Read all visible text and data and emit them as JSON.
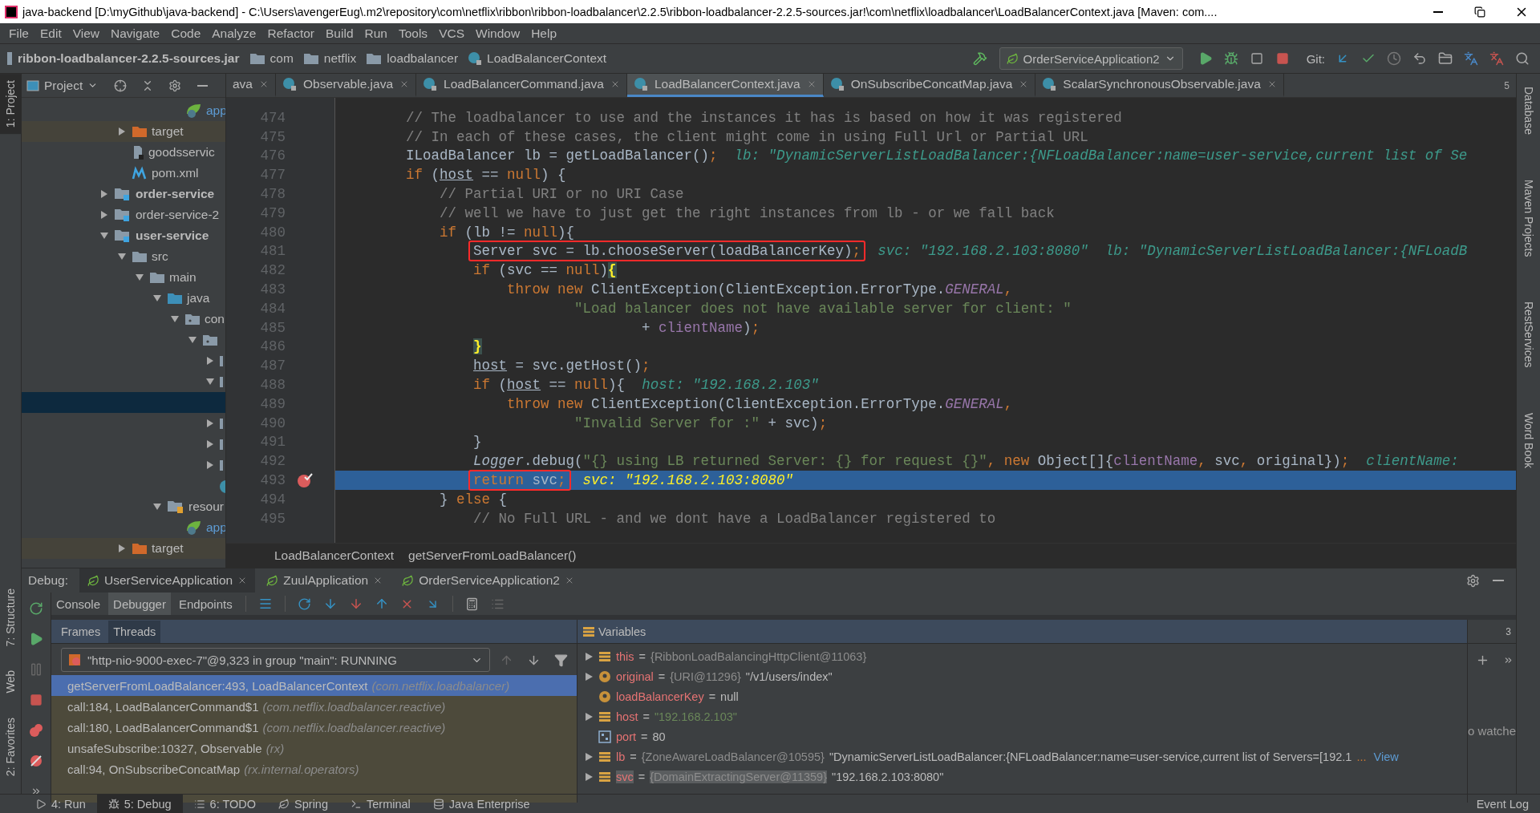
{
  "window": {
    "title": "java-backend [D:\\myGithub\\java-backend] - C:\\Users\\avengerEug\\.m2\\repository\\com\\netflix\\ribbon\\ribbon-loadbalancer\\2.2.5\\ribbon-loadbalancer-2.2.5-sources.jar!\\com\\netflix\\loadbalancer\\LoadBalancerContext.java [Maven: com...."
  },
  "menu": [
    "File",
    "Edit",
    "View",
    "Navigate",
    "Code",
    "Analyze",
    "Refactor",
    "Build",
    "Run",
    "Tools",
    "VCS",
    "Window",
    "Help"
  ],
  "nav_bar": {
    "path": [
      {
        "label": "ribbon-loadbalancer-2.2.5-sources.jar",
        "kind": "jar"
      },
      {
        "label": "com",
        "kind": "package"
      },
      {
        "label": "netflix",
        "kind": "package"
      },
      {
        "label": "loadbalancer",
        "kind": "package"
      },
      {
        "label": "LoadBalancerContext",
        "kind": "class"
      }
    ],
    "run_config": "OrderServiceApplication2",
    "git_label": "Git:"
  },
  "left_stripe": [
    {
      "label": "1: Project",
      "selected": true
    },
    {
      "label": "7: Structure",
      "selected": false
    },
    {
      "label": "Web",
      "selected": false
    },
    {
      "label": "2: Favorites",
      "selected": false
    }
  ],
  "right_stripe": [
    "Database",
    "Maven Projects",
    "RestServices",
    "Word Book"
  ],
  "project": {
    "title": "Project",
    "tree": [
      {
        "children": [
          {
            "children": [
              {
                "children": [
                  {
                    "children": [
                      {
                        "label": "app",
                        "kind": "spring-config"
                      }
                    ]
                  }
                ]
              }
            ]
          },
          {
            "label": "target",
            "kind": "excluded",
            "expanded": false,
            "highlighted": true
          },
          {
            "label": "goodsservic",
            "kind": "iml"
          },
          {
            "label": "pom.xml",
            "kind": "maven"
          }
        ]
      },
      {
        "label": "order-service",
        "kind": "module",
        "bold": true,
        "expanded": false
      },
      {
        "label": "order-service-2",
        "kind": "module",
        "bold": false,
        "expanded": false
      },
      {
        "label": "user-service",
        "kind": "module",
        "bold": true,
        "expanded": true,
        "children": [
          {
            "label": "src",
            "kind": "folder",
            "expanded": true,
            "children": [
              {
                "label": "main",
                "kind": "folder",
                "expanded": true,
                "children": [
                  {
                    "label": "java",
                    "kind": "source",
                    "expanded": true,
                    "children": [
                      {
                        "label": "con",
                        "kind": "package",
                        "expanded": true,
                        "children": [
                          {
                            "kind": "package",
                            "expanded": true,
                            "children": [
                              {
                                "kind": "cut",
                                "expanded": false
                              },
                              {
                                "kind": "cut",
                                "expanded": true,
                                "children": [
                                  {
                                    "selected": true
                                  }
                                ]
                              },
                              {
                                "kind": "cut",
                                "expanded": false
                              },
                              {
                                "kind": "cut",
                                "expanded": false
                              },
                              {
                                "kind": "cut",
                                "expanded": false
                              },
                              {
                                "kind": "spring-class"
                              }
                            ]
                          }
                        ]
                      }
                    ]
                  },
                  {
                    "label": "resour",
                    "kind": "resources",
                    "expanded": true,
                    "children": [
                      {
                        "label": "app",
                        "kind": "spring-config"
                      }
                    ]
                  }
                ]
              }
            ]
          },
          {
            "label": "target",
            "kind": "excluded",
            "expanded": false,
            "highlighted": true
          }
        ]
      }
    ]
  },
  "editor": {
    "tabs": [
      {
        "label": "ava",
        "selected": false,
        "icon": false
      },
      {
        "label": "Observable.java",
        "selected": false,
        "icon": true
      },
      {
        "label": "LoadBalancerCommand.java",
        "selected": false,
        "icon": true
      },
      {
        "label": "LoadBalancerContext.java",
        "selected": true,
        "icon": true
      },
      {
        "label": "OnSubscribeConcatMap.java",
        "selected": false,
        "icon": true
      },
      {
        "label": "ScalarSynchronousObservable.java",
        "selected": false,
        "icon": true
      }
    ],
    "tab_count": "5",
    "lines": [
      {
        "number": "474",
        "tokens": [
          {
            "kind": "comment",
            "text": "        // The loadbalancer to use and the instances it has is based on how it was registered"
          }
        ],
        "current": false,
        "breakpoint": false,
        "boxed": false
      },
      {
        "number": "475",
        "tokens": [
          {
            "kind": "comment",
            "text": "        // In each of these cases, the client might come in using Full Url or Partial URL"
          }
        ],
        "current": false,
        "breakpoint": false,
        "boxed": false
      },
      {
        "number": "476",
        "tokens": [
          {
            "kind": "plain",
            "text": "        ILoadBalancer lb = getLoadBalancer()"
          },
          {
            "kind": "punct",
            "text": ";"
          }
        ],
        "hint": "lb: \"DynamicServerListLoadBalancer:{NFLoadBalancer:name=user-service,current list of Se",
        "current": false,
        "breakpoint": false,
        "boxed": false
      },
      {
        "number": "477",
        "tokens": [
          {
            "kind": "keyword",
            "text": "        if"
          },
          {
            "kind": "plain",
            "text": " ("
          },
          {
            "kind": "underline",
            "text": "host"
          },
          {
            "kind": "plain",
            "text": " == "
          },
          {
            "kind": "keyword",
            "text": "null"
          },
          {
            "kind": "plain",
            "text": ") {"
          }
        ],
        "current": false,
        "breakpoint": false,
        "boxed": false
      },
      {
        "number": "478",
        "tokens": [
          {
            "kind": "comment",
            "text": "            // Partial URI or no URI Case"
          }
        ],
        "current": false,
        "breakpoint": false,
        "boxed": false
      },
      {
        "number": "479",
        "tokens": [
          {
            "kind": "comment",
            "text": "            // well we have to just get the right instances from lb - or we fall back"
          }
        ],
        "current": false,
        "breakpoint": false,
        "boxed": false
      },
      {
        "number": "480",
        "tokens": [
          {
            "kind": "keyword",
            "text": "            if"
          },
          {
            "kind": "plain",
            "text": " (lb != "
          },
          {
            "kind": "keyword",
            "text": "null"
          },
          {
            "kind": "plain",
            "text": "){"
          }
        ],
        "current": false,
        "breakpoint": false,
        "boxed": false
      },
      {
        "number": "481",
        "tokens": [
          {
            "kind": "plain",
            "text": "                Server svc = lb.chooseServer(loadBalancerKey)"
          },
          {
            "kind": "punct",
            "text": ";"
          }
        ],
        "hint": "svc: \"192.168.2.103:8080\"  lb: \"DynamicServerListLoadBalancer:{NFLoadB",
        "current": false,
        "breakpoint": false,
        "boxed": true
      },
      {
        "number": "482",
        "tokens": [
          {
            "kind": "keyword",
            "text": "                if"
          },
          {
            "kind": "plain",
            "text": " (svc == "
          },
          {
            "kind": "keyword",
            "text": "null"
          },
          {
            "kind": "plain",
            "text": ")"
          },
          {
            "kind": "brace",
            "text": "{"
          }
        ],
        "current": false,
        "breakpoint": false,
        "boxed": false
      },
      {
        "number": "483",
        "tokens": [
          {
            "kind": "keyword",
            "text": "                    throw new "
          },
          {
            "kind": "plain",
            "text": "ClientException(ClientException.ErrorType."
          },
          {
            "kind": "constant",
            "text": "GENERAL"
          },
          {
            "kind": "punct",
            "text": ","
          }
        ],
        "current": false,
        "breakpoint": false,
        "boxed": false
      },
      {
        "number": "484",
        "tokens": [
          {
            "kind": "string",
            "text": "                            \"Load balancer does not have available server for client: \""
          }
        ],
        "current": false,
        "breakpoint": false,
        "boxed": false
      },
      {
        "number": "485",
        "tokens": [
          {
            "kind": "plain",
            "text": "                                    + "
          },
          {
            "kind": "field",
            "text": "clientName"
          },
          {
            "kind": "plain",
            "text": ")"
          },
          {
            "kind": "punct",
            "text": ";"
          }
        ],
        "current": false,
        "breakpoint": false,
        "boxed": false
      },
      {
        "number": "486",
        "tokens": [
          {
            "kind": "brace",
            "text": "                }"
          }
        ],
        "current": false,
        "breakpoint": false,
        "boxed": false
      },
      {
        "number": "487",
        "tokens": [
          {
            "kind": "underline",
            "text": "                host"
          },
          {
            "kind": "plain",
            "text": " = svc.getHost()"
          },
          {
            "kind": "punct",
            "text": ";"
          }
        ],
        "current": false,
        "breakpoint": false,
        "boxed": false
      },
      {
        "number": "488",
        "tokens": [
          {
            "kind": "keyword",
            "text": "                if"
          },
          {
            "kind": "plain",
            "text": " ("
          },
          {
            "kind": "underline",
            "text": "host"
          },
          {
            "kind": "plain",
            "text": " == "
          },
          {
            "kind": "keyword",
            "text": "null"
          },
          {
            "kind": "plain",
            "text": "){"
          }
        ],
        "hint": "host: \"192.168.2.103\"",
        "current": false,
        "breakpoint": false,
        "boxed": false
      },
      {
        "number": "489",
        "tokens": [
          {
            "kind": "keyword",
            "text": "                    throw new "
          },
          {
            "kind": "plain",
            "text": "ClientException(ClientException.ErrorType."
          },
          {
            "kind": "constant",
            "text": "GENERAL"
          },
          {
            "kind": "punct",
            "text": ","
          }
        ],
        "current": false,
        "breakpoint": false,
        "boxed": false
      },
      {
        "number": "490",
        "tokens": [
          {
            "kind": "string",
            "text": "                            \"Invalid Server for :\""
          },
          {
            "kind": "plain",
            "text": " + svc)"
          },
          {
            "kind": "punct",
            "text": ";"
          }
        ],
        "current": false,
        "breakpoint": false,
        "boxed": false
      },
      {
        "number": "491",
        "tokens": [
          {
            "kind": "plain",
            "text": "                }"
          }
        ],
        "current": false,
        "breakpoint": false,
        "boxed": false
      },
      {
        "number": "492",
        "tokens": [
          {
            "kind": "static",
            "text": "                Logger"
          },
          {
            "kind": "plain",
            "text": ".debug("
          },
          {
            "kind": "string",
            "text": "\"{} using LB returned Server: {} for request {}\""
          },
          {
            "kind": "punct",
            "text": ", "
          },
          {
            "kind": "keyword",
            "text": "new "
          },
          {
            "kind": "plain",
            "text": "Object[]{"
          },
          {
            "kind": "field",
            "text": "clientName"
          },
          {
            "kind": "punct",
            "text": ", "
          },
          {
            "kind": "plain",
            "text": "svc"
          },
          {
            "kind": "punct",
            "text": ", "
          },
          {
            "kind": "plain",
            "text": "original})"
          },
          {
            "kind": "punct",
            "text": ";"
          }
        ],
        "hint": "clientName:",
        "current": false,
        "breakpoint": false,
        "boxed": false
      },
      {
        "number": "493",
        "tokens": [
          {
            "kind": "keyword",
            "text": "                return "
          },
          {
            "kind": "plain",
            "text": "svc"
          },
          {
            "kind": "punct",
            "text": ";"
          }
        ],
        "hint": "svc: \"192.168.2.103:8080\"",
        "current": true,
        "breakpoint": true,
        "boxed": true
      },
      {
        "number": "494",
        "tokens": [
          {
            "kind": "plain",
            "text": "            } "
          },
          {
            "kind": "keyword",
            "text": "else"
          },
          {
            "kind": "plain",
            "text": " {"
          }
        ],
        "current": false,
        "breakpoint": false,
        "boxed": false
      },
      {
        "number": "495",
        "tokens": [
          {
            "kind": "comment",
            "text": "                // No Full URL - and we dont have a LoadBalancer registered to"
          }
        ],
        "current": false,
        "breakpoint": false,
        "boxed": false
      }
    ],
    "breadcrumb": [
      "LoadBalancerContext",
      "getServerFromLoadBalancer()"
    ]
  },
  "debug": {
    "title": "Debug:",
    "sessions": [
      {
        "label": "UserServiceApplication",
        "selected": true
      },
      {
        "label": "ZuulApplication",
        "selected": false
      },
      {
        "label": "OrderServiceApplication2",
        "selected": false
      }
    ],
    "views": [
      {
        "label": "Console",
        "selected": false
      },
      {
        "label": "Debugger",
        "selected": true
      },
      {
        "label": "Endpoints",
        "selected": false
      }
    ],
    "frame_tabs": [
      {
        "label": "Frames",
        "selected": false
      },
      {
        "label": "Threads",
        "selected": true
      }
    ],
    "thread": "\"http-nio-9000-exec-7\"@9,323 in group \"main\": RUNNING",
    "frames": [
      {
        "method": "getServerFromLoadBalancer:493, LoadBalancerContext",
        "package": "(com.netflix.loadbalancer)",
        "selected": true
      },
      {
        "method": "call:184, LoadBalancerCommand$1",
        "package": "(com.netflix.loadbalancer.reactive)",
        "selected": false
      },
      {
        "method": "call:180, LoadBalancerCommand$1",
        "package": "(com.netflix.loadbalancer.reactive)",
        "selected": false
      },
      {
        "method": "unsafeSubscribe:10327, Observable",
        "package": "(rx)",
        "selected": false
      },
      {
        "method": "call:94, OnSubscribeConcatMap",
        "package": "(rx.internal.operators)",
        "selected": false
      }
    ],
    "variables_title": "Variables",
    "watch_count": "3",
    "variables": [
      {
        "name": "this",
        "operator": "=",
        "type": "{RibbonLoadBalancingHttpClient@11063}",
        "kind": "field",
        "expandable": true,
        "selected": false
      },
      {
        "name": "original",
        "operator": "=",
        "type": "{URI@11296}",
        "value": "\"/v1/users/index\"",
        "string_value": false,
        "kind": "param",
        "expandable": true,
        "selected": false
      },
      {
        "name": "loadBalancerKey",
        "operator": "=",
        "value": "null",
        "string_value": false,
        "kind": "param",
        "expandable": false,
        "selected": false
      },
      {
        "name": "host",
        "operator": "=",
        "value": "\"192.168.2.103\"",
        "string_value": true,
        "kind": "field",
        "expandable": true,
        "selected": false
      },
      {
        "name": "port",
        "operator": "=",
        "value": "80",
        "string_value": false,
        "kind": "primitive",
        "expandable": false,
        "selected": false
      },
      {
        "name": "lb",
        "operator": "=",
        "type": "{ZoneAwareLoadBalancer@10595}",
        "value": "\"DynamicServerListLoadBalancer:{NFLoadBalancer:name=user-service,current list of Servers=[192.1",
        "string_value": false,
        "more": "...",
        "link": "View",
        "kind": "field",
        "expandable": true,
        "selected": false
      },
      {
        "name": "svc",
        "operator": "=",
        "type": "{DomainExtractingServer@11359}",
        "value": "\"192.168.2.103:8080\"",
        "string_value": false,
        "kind": "field",
        "expandable": true,
        "selected": true
      }
    ],
    "watches_text": "o watche"
  },
  "bottom_bar": {
    "items": [
      {
        "label": "4: Run",
        "selected": false
      },
      {
        "label": "5: Debug",
        "selected": true
      },
      {
        "label": "6: TODO",
        "selected": false
      },
      {
        "label": "Spring",
        "selected": false
      },
      {
        "label": "Terminal",
        "selected": false
      },
      {
        "label": "Java Enterprise",
        "selected": false
      }
    ],
    "event_log": "Event Log"
  }
}
